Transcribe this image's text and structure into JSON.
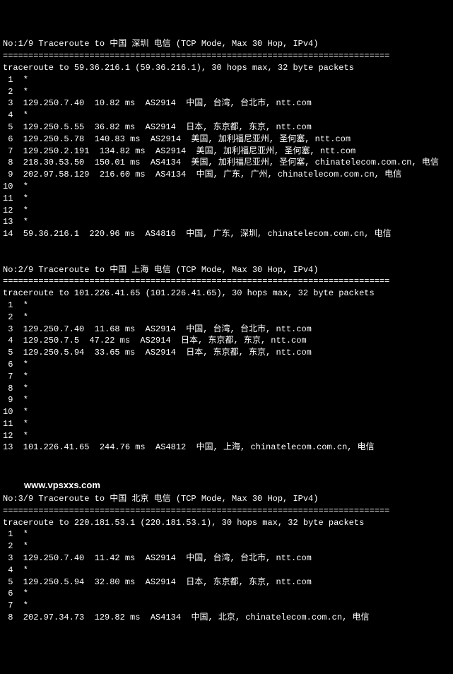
{
  "blocks": [
    {
      "title": "No:1/9 Traceroute to 中国 深圳 电信 (TCP Mode, Max 30 Hop, IPv4)",
      "sep": "============================================================================",
      "sub": "traceroute to 59.36.216.1 (59.36.216.1), 30 hops max, 32 byte packets",
      "hops": [
        {
          "n": "1",
          "rest": "*"
        },
        {
          "n": "2",
          "rest": "*"
        },
        {
          "n": "3",
          "rest": "129.250.7.40  10.82 ms  AS2914  中国, 台湾, 台北市, ntt.com"
        },
        {
          "n": "4",
          "rest": "*"
        },
        {
          "n": "5",
          "rest": "129.250.5.55  36.82 ms  AS2914  日本, 东京都, 东京, ntt.com"
        },
        {
          "n": "6",
          "rest": "129.250.5.78  140.83 ms  AS2914  美国, 加利福尼亚州, 圣何塞, ntt.com"
        },
        {
          "n": "7",
          "rest": "129.250.2.191  134.82 ms  AS2914  美国, 加利福尼亚州, 圣何塞, ntt.com"
        },
        {
          "n": "8",
          "rest": "218.30.53.50  150.01 ms  AS4134  美国, 加利福尼亚州, 圣何塞, chinatelecom.com.cn, 电信"
        },
        {
          "n": "9",
          "rest": "202.97.58.129  216.60 ms  AS4134  中国, 广东, 广州, chinatelecom.com.cn, 电信"
        },
        {
          "n": "10",
          "rest": "*"
        },
        {
          "n": "11",
          "rest": "*"
        },
        {
          "n": "12",
          "rest": "*"
        },
        {
          "n": "13",
          "rest": "*"
        },
        {
          "n": "14",
          "rest": "59.36.216.1  220.96 ms  AS4816  中国, 广东, 深圳, chinatelecom.com.cn, 电信"
        }
      ]
    },
    {
      "title": "No:2/9 Traceroute to 中国 上海 电信 (TCP Mode, Max 30 Hop, IPv4)",
      "sep": "============================================================================",
      "sub": "traceroute to 101.226.41.65 (101.226.41.65), 30 hops max, 32 byte packets",
      "hops": [
        {
          "n": "1",
          "rest": "*"
        },
        {
          "n": "2",
          "rest": "*"
        },
        {
          "n": "3",
          "rest": "129.250.7.40  11.68 ms  AS2914  中国, 台湾, 台北市, ntt.com"
        },
        {
          "n": "4",
          "rest": "129.250.7.5  47.22 ms  AS2914  日本, 东京都, 东京, ntt.com"
        },
        {
          "n": "5",
          "rest": "129.250.5.94  33.65 ms  AS2914  日本, 东京都, 东京, ntt.com"
        },
        {
          "n": "6",
          "rest": "*"
        },
        {
          "n": "7",
          "rest": "*"
        },
        {
          "n": "8",
          "rest": "*"
        },
        {
          "n": "9",
          "rest": "*"
        },
        {
          "n": "10",
          "rest": "*"
        },
        {
          "n": "11",
          "rest": "*"
        },
        {
          "n": "12",
          "rest": "*"
        },
        {
          "n": "13",
          "rest": "101.226.41.65  244.76 ms  AS4812  中国, 上海, chinatelecom.com.cn, 电信"
        }
      ]
    },
    {
      "title": "No:3/9 Traceroute to 中国 北京 电信 (TCP Mode, Max 30 Hop, IPv4)",
      "sep": "============================================================================",
      "sub": "traceroute to 220.181.53.1 (220.181.53.1), 30 hops max, 32 byte packets",
      "hops": [
        {
          "n": "1",
          "rest": "*"
        },
        {
          "n": "2",
          "rest": "*"
        },
        {
          "n": "3",
          "rest": "129.250.7.40  11.42 ms  AS2914  中国, 台湾, 台北市, ntt.com"
        },
        {
          "n": "4",
          "rest": "*"
        },
        {
          "n": "5",
          "rest": "129.250.5.94  32.80 ms  AS2914  日本, 东京都, 东京, ntt.com"
        },
        {
          "n": "6",
          "rest": "*"
        },
        {
          "n": "7",
          "rest": "*"
        },
        {
          "n": "8",
          "rest": "202.97.34.73  129.82 ms  AS4134  中国, 北京, chinatelecom.com.cn, 电信"
        }
      ]
    }
  ],
  "watermark": "www.vpsxxs.com"
}
